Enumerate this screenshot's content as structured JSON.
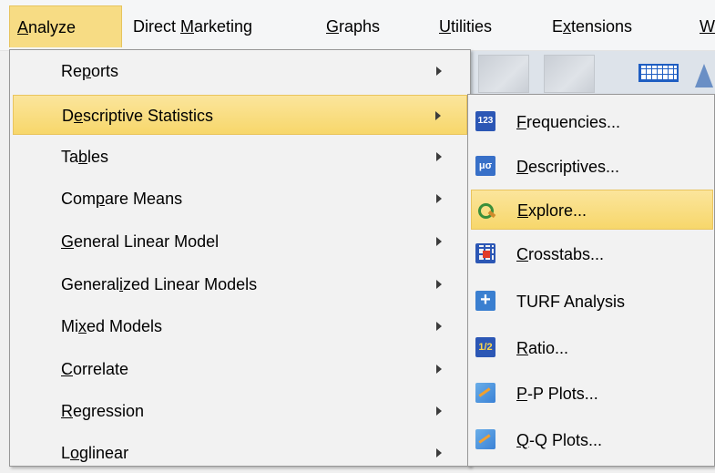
{
  "menubar": {
    "items": [
      {
        "label": "Analyze",
        "mnemonic": "A",
        "rest": "nalyze",
        "active": true
      },
      {
        "label": "Direct Marketing",
        "pre": "Direct ",
        "mnemonic": "M",
        "rest": "arketing"
      },
      {
        "label": "Graphs",
        "mnemonic": "G",
        "rest": "raphs"
      },
      {
        "label": "Utilities",
        "mnemonic": "U",
        "rest": "tilities"
      },
      {
        "label": "Extensions",
        "pre": "E",
        "mnemonic": "x",
        "rest": "tensions"
      },
      {
        "label": "W",
        "mnemonic": "W",
        "rest": ""
      }
    ]
  },
  "analyze_menu": {
    "items": [
      {
        "pre": "Re",
        "mnemonic": "p",
        "rest": "orts"
      },
      {
        "pre": "D",
        "mnemonic": "e",
        "rest": "scriptive Statistics"
      },
      {
        "pre": "Ta",
        "mnemonic": "b",
        "rest": "les"
      },
      {
        "pre": "Com",
        "mnemonic": "p",
        "rest": "are Means"
      },
      {
        "pre": "",
        "mnemonic": "G",
        "rest": "eneral Linear Model"
      },
      {
        "pre": "General",
        "mnemonic": "i",
        "rest": "zed Linear Models"
      },
      {
        "pre": "Mi",
        "mnemonic": "x",
        "rest": "ed Models"
      },
      {
        "pre": "",
        "mnemonic": "C",
        "rest": "orrelate"
      },
      {
        "pre": "",
        "mnemonic": "R",
        "rest": "egression"
      },
      {
        "pre": "L",
        "mnemonic": "o",
        "rest": "glinear"
      }
    ]
  },
  "descriptive_submenu": {
    "items": [
      {
        "pre": "",
        "mnemonic": "F",
        "rest": "requencies...",
        "icon": "frequencies-icon",
        "icon_text": "123"
      },
      {
        "pre": "",
        "mnemonic": "D",
        "rest": "escriptives...",
        "icon": "descriptives-icon",
        "icon_text": "μσ"
      },
      {
        "pre": "",
        "mnemonic": "E",
        "rest": "xplore...",
        "icon": "explore-icon",
        "icon_text": ""
      },
      {
        "pre": "",
        "mnemonic": "C",
        "rest": "rosstabs...",
        "icon": "crosstabs-icon",
        "icon_text": ""
      },
      {
        "pre": "TURF Analysis",
        "mnemonic": "",
        "rest": "",
        "icon": "turf-icon",
        "icon_text": "+"
      },
      {
        "pre": "",
        "mnemonic": "R",
        "rest": "atio...",
        "icon": "ratio-icon",
        "icon_text": "1/2"
      },
      {
        "pre": "",
        "mnemonic": "P",
        "rest": "-P Plots...",
        "icon": "pp-plots-icon",
        "icon_text": ""
      },
      {
        "pre": "",
        "mnemonic": "Q",
        "rest": "-Q Plots...",
        "icon": "qq-plots-icon",
        "icon_text": ""
      }
    ]
  },
  "colors": {
    "highlight": "#f7d76b",
    "menu_bg": "#f2f2f2",
    "icon_blue": "#2c57b5"
  }
}
